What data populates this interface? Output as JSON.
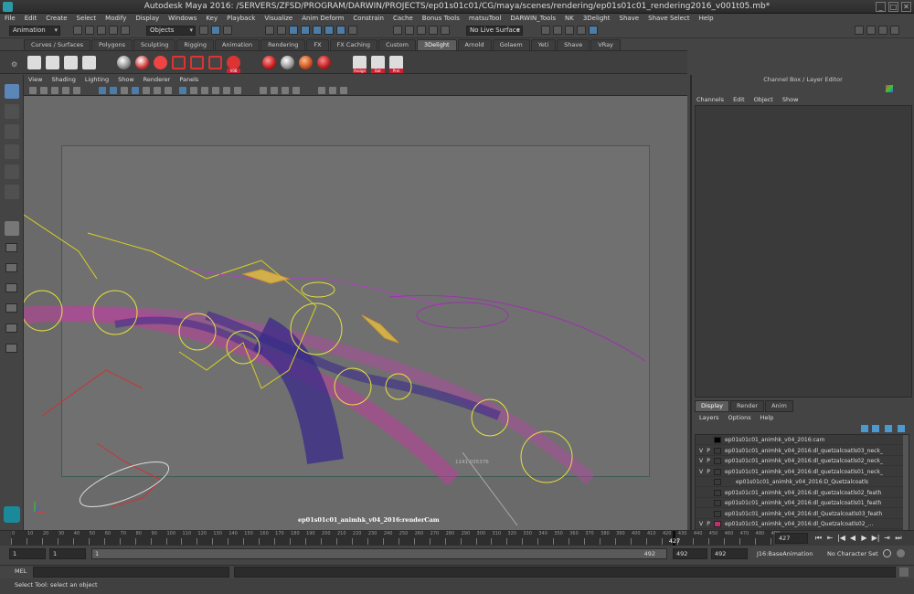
{
  "window": {
    "title": "Autodesk Maya 2016: /SERVERS/ZFSD/PROGRAM/DARWIN/PROJECTS/ep01s01c01/CG/maya/scenes/rendering/ep01s01c01_rendering2016_v001t05.mb*",
    "minimize": "_",
    "maximize": "□",
    "close": "✕"
  },
  "menubar": [
    "File",
    "Edit",
    "Create",
    "Select",
    "Modify",
    "Display",
    "Windows",
    "Key",
    "Playback",
    "Visualize",
    "Anim Deform",
    "Constrain",
    "Cache",
    "Bonus Tools",
    "matsuTool",
    "DARWIN_Tools",
    "NK",
    "3Delight",
    "Shave",
    "Shave Select",
    "Help"
  ],
  "statusline": {
    "menu_set": "Animation",
    "selection_mode": "Objects",
    "live_surface": "No Live Surface"
  },
  "shelf_tabs": [
    "Curves / Surfaces",
    "Polygons",
    "Sculpting",
    "Rigging",
    "Animation",
    "Rendering",
    "FX",
    "FX Caching",
    "Custom",
    "3Delight",
    "Arnold",
    "Golaem",
    "Yeti",
    "Shave",
    "VRay"
  ],
  "shelf_active_tab": "3Delight",
  "shelf_labels": {
    "v08": "V08",
    "assign": "Assign",
    "bat": "Bat",
    "prel": "Prel"
  },
  "panel_menu": [
    "View",
    "Shading",
    "Lighting",
    "Show",
    "Renderer",
    "Panels"
  ],
  "viewport": {
    "camera_label": "ep01s01c01_animhk_v04_2016:renderCam",
    "coord_readout": "1141.035376"
  },
  "channel_box": {
    "title": "Channel Box / Layer Editor",
    "menu": [
      "Channels",
      "Edit",
      "Object",
      "Show"
    ]
  },
  "layer_editor": {
    "tabs": [
      "Display",
      "Render",
      "Anim"
    ],
    "active_tab": "Display",
    "menu": [
      "Layers",
      "Options",
      "Help"
    ],
    "layers": [
      {
        "v": "",
        "p": "",
        "color": "#000000",
        "name": "ep01s01c01_animhk_v04_2016:cam"
      },
      {
        "v": "V",
        "p": "P",
        "color": "#3a3a3a",
        "name": "ep01s01c01_animhk_v04_2016:dl_quetzalcoatls03_neck_"
      },
      {
        "v": "V",
        "p": "P",
        "color": "#3a3a3a",
        "name": "ep01s01c01_animhk_v04_2016:dl_quetzalcoatls02_neck_"
      },
      {
        "v": "V",
        "p": "P",
        "color": "#3a3a3a",
        "name": "ep01s01c01_animhk_v04_2016:dl_quetzalcoatls01_neck_"
      },
      {
        "v": "",
        "p": "",
        "color": "#3a3a3a",
        "name": "ep01s01c01_animhk_v04_2016:D_Quetzalcoatls"
      },
      {
        "v": "",
        "p": "",
        "color": "#3a3a3a",
        "name": "ep01s01c01_animhk_v04_2016:dl_quetzalcoatls02_feath"
      },
      {
        "v": "",
        "p": "",
        "color": "#3a3a3a",
        "name": "ep01s01c01_animhk_v04_2016:dl_quetzalcoatls01_feath"
      },
      {
        "v": "",
        "p": "",
        "color": "#3a3a3a",
        "name": "ep01s01c01_animhk_v04_2016:dl_Quetzalcoatls03_feath"
      },
      {
        "v": "V",
        "p": "P",
        "color": "#c0306a",
        "name": "ep01s01c01_animhk_v04_2016:dl_Quetzalcoatls02_..."
      }
    ]
  },
  "timeline": {
    "ticks": [
      "0",
      "10",
      "20",
      "30",
      "40",
      "50",
      "60",
      "70",
      "80",
      "90",
      "100",
      "110",
      "120",
      "130",
      "140",
      "150",
      "160",
      "170",
      "180",
      "190",
      "200",
      "210",
      "220",
      "230",
      "240",
      "250",
      "260",
      "270",
      "280",
      "290",
      "300",
      "310",
      "320",
      "330",
      "340",
      "350",
      "360",
      "370",
      "380",
      "390",
      "400",
      "410",
      "420",
      "430",
      "440",
      "450",
      "460",
      "470",
      "480",
      "490"
    ],
    "current_frame": "427",
    "current_frame_field": "427"
  },
  "range": {
    "start": "1",
    "playback_start": "1",
    "slider_start": "1",
    "slider_end": "492",
    "playback_end": "492",
    "end": "492",
    "anim_layer": "J16:BaseAnimation",
    "character_set": "No Character Set"
  },
  "command_line": {
    "label": "MEL"
  },
  "help_line": "Select Tool: select an object"
}
